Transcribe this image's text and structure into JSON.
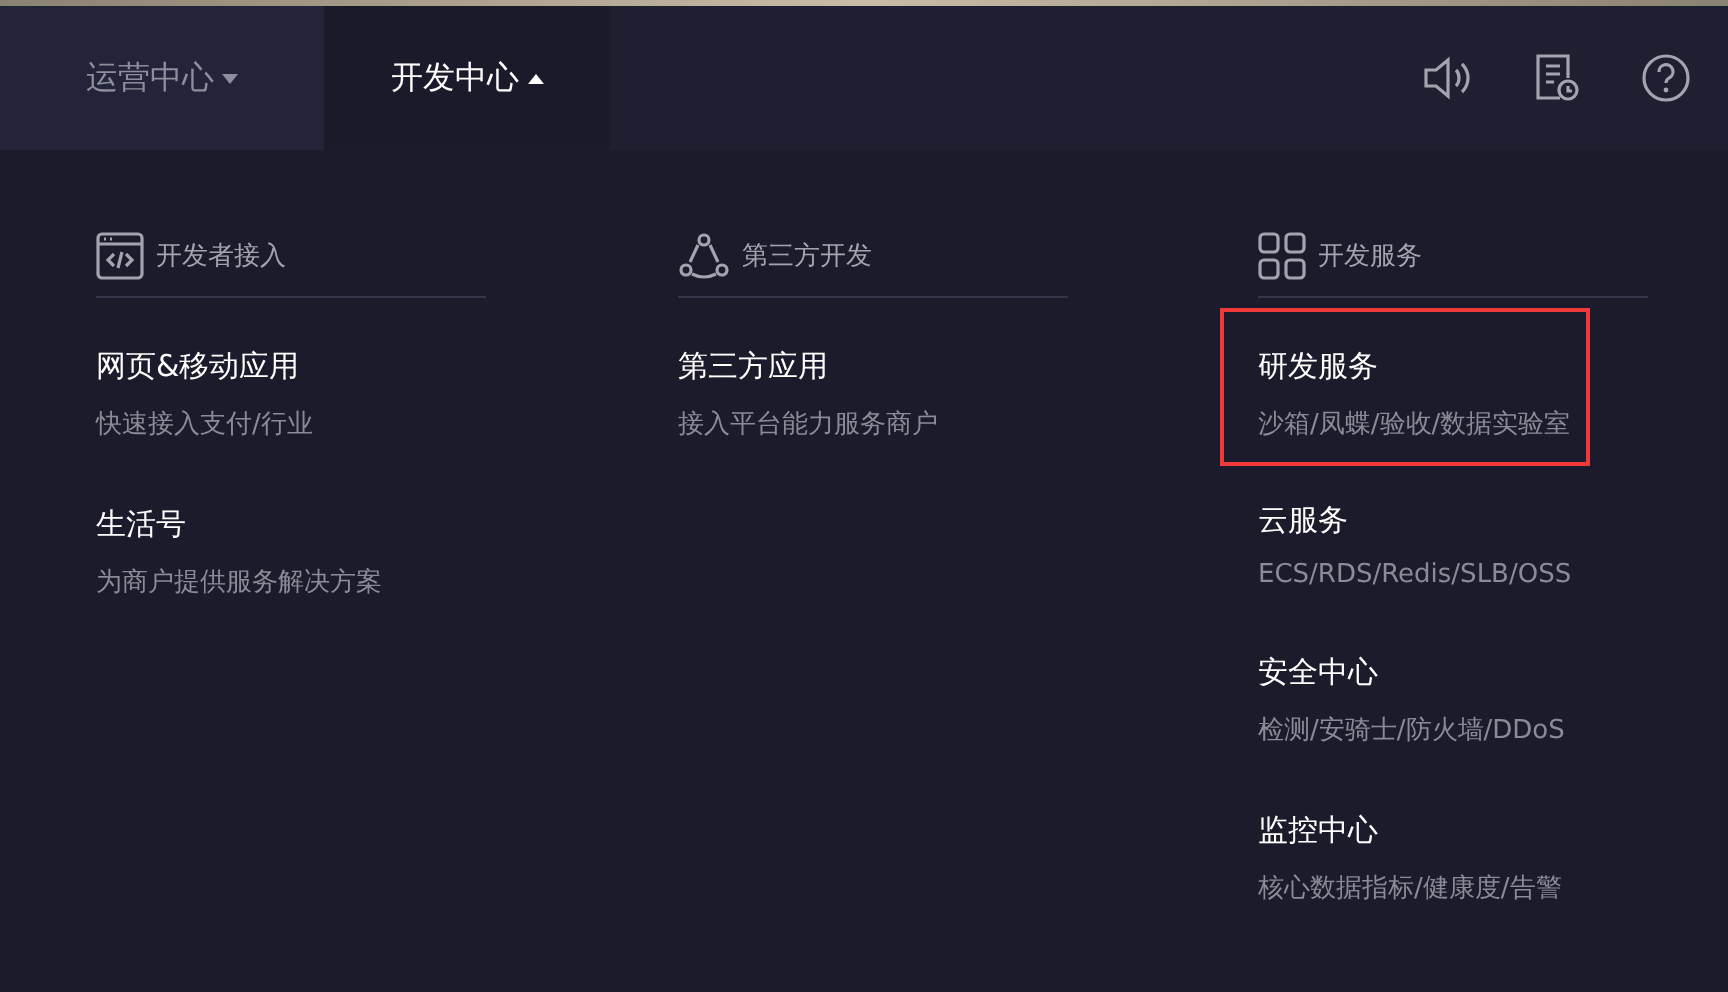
{
  "nav_tabs": [
    {
      "label": "运营中心",
      "selected": false,
      "expanded": false
    },
    {
      "label": "开发中心",
      "selected": true,
      "expanded": true
    }
  ],
  "toolbar": [
    {
      "kind": "sound"
    },
    {
      "kind": "log"
    },
    {
      "kind": "help"
    }
  ],
  "columns": [
    {
      "title": "开发者接入",
      "items": [
        {
          "title": "网页&移动应用",
          "subtitle": "快速接入支付/行业",
          "highlighted": false
        },
        {
          "title": "生活号",
          "subtitle": "为商户提供服务解决方案",
          "highlighted": false
        }
      ]
    },
    {
      "title": "第三方开发",
      "items": [
        {
          "title": "第三方应用",
          "subtitle": "接入平台能力服务商户",
          "highlighted": false
        }
      ]
    },
    {
      "title": "开发服务",
      "items": [
        {
          "title": "研发服务",
          "subtitle": "沙箱/凤蝶/验收/数据实验室",
          "highlighted": true
        },
        {
          "title": "云服务",
          "subtitle": "ECS/RDS/Redis/SLB/OSS",
          "highlighted": false
        },
        {
          "title": "安全中心",
          "subtitle": "检测/安骑士/防火墙/DDoS",
          "highlighted": false
        },
        {
          "title": "监控中心",
          "subtitle": "核心数据指标/健康度/告警",
          "highlighted": false
        }
      ]
    }
  ]
}
